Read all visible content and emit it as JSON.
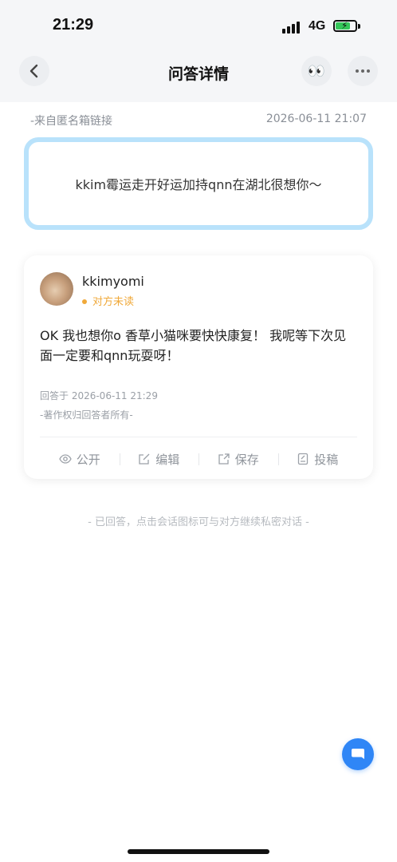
{
  "status_bar": {
    "time": "21:29",
    "network": "4G",
    "battery_fraction": 0.75
  },
  "header": {
    "title": "问答详情",
    "eyes_emoji": "👀"
  },
  "meta": {
    "source": "-来自匿名箱链接",
    "timestamp": "2026-06-11 21:07"
  },
  "question": {
    "text": "kkim霉运走开好运加持qnn在湖北很想你～"
  },
  "answer": {
    "username": "kkimyomi",
    "read_status": "对方未读",
    "text": "OK 我也想你o 香草小猫咪要快快康复！ 我呢等下次见面一定要和qnn玩耍呀！",
    "answered_at": "回答于 2026-06-11 21:29",
    "copyright": "-著作权归回答者所有-",
    "actions": [
      {
        "label": "公开",
        "icon": "eye-icon"
      },
      {
        "label": "编辑",
        "icon": "edit-icon"
      },
      {
        "label": "保存",
        "icon": "export-icon"
      },
      {
        "label": "投稿",
        "icon": "submit-icon"
      }
    ]
  },
  "footer_hint": "- 已回答，点击会话图标可与对方继续私密对话 -",
  "colors": {
    "accent": "#2f86f6",
    "question_border": "#b9e2fb",
    "unread": "#f0a93a"
  }
}
